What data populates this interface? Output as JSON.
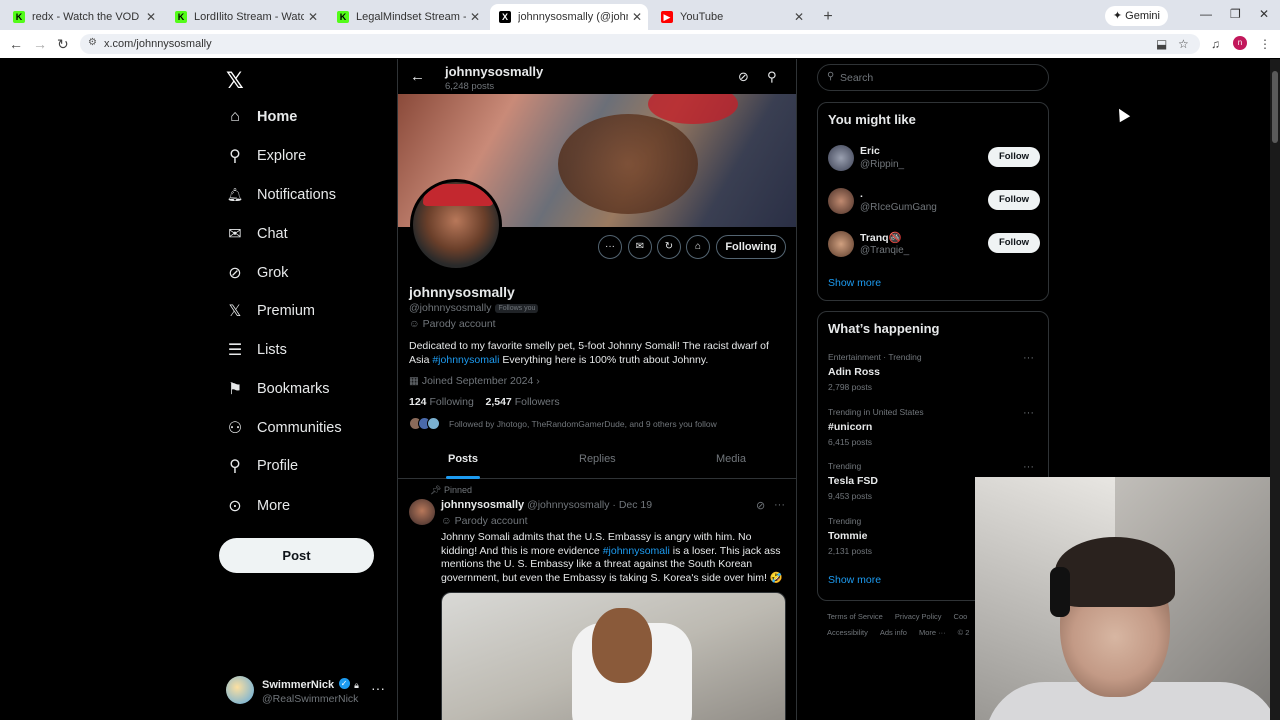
{
  "browser": {
    "tabs": [
      {
        "title": "redx - Watch the VOD on Kick",
        "favicon": "K",
        "color": "#53fc18"
      },
      {
        "title": "LordIlito Stream - Watch Live on Kick",
        "favicon": "K",
        "color": "#53fc18"
      },
      {
        "title": "LegalMindset Stream - Watch Live on Kick",
        "favicon": "K",
        "color": "#53fc18"
      },
      {
        "title": "johnnysosmally (@johnnysosmally) / X",
        "favicon": "X",
        "color": "#000000"
      },
      {
        "title": "YouTube",
        "favicon": "▶",
        "color": "#ff0000"
      }
    ],
    "new_tab": "+",
    "gemini_label": "Gemini",
    "url": "x.com/johnnysosmally",
    "profile_initial": "n"
  },
  "nav": {
    "logo": "𝕏",
    "items": [
      {
        "label": "Home",
        "icon": "home-icon",
        "glyph": "⌂"
      },
      {
        "label": "Explore",
        "icon": "search-icon",
        "glyph": "⚲"
      },
      {
        "label": "Notifications",
        "icon": "bell-icon",
        "glyph": "🔔︎"
      },
      {
        "label": "Chat",
        "icon": "mail-icon",
        "glyph": "✉"
      },
      {
        "label": "Grok",
        "icon": "grok-icon",
        "glyph": "⊘"
      },
      {
        "label": "Premium",
        "icon": "x-logo-icon",
        "glyph": "𝕏"
      },
      {
        "label": "Lists",
        "icon": "lists-icon",
        "glyph": "☰"
      },
      {
        "label": "Bookmarks",
        "icon": "bookmark-icon",
        "glyph": "⚑"
      },
      {
        "label": "Communities",
        "icon": "communities-icon",
        "glyph": "⚇"
      },
      {
        "label": "Profile",
        "icon": "person-icon",
        "glyph": "⚲"
      },
      {
        "label": "More",
        "icon": "more-circle-icon",
        "glyph": "⊙"
      }
    ],
    "post_button": "Post",
    "me": {
      "name": "SwimmerNick",
      "handle": "@RealSwimmerNick"
    }
  },
  "profile": {
    "topbar_name": "johnnysosmally",
    "topbar_posts": "6,248 posts",
    "following_button": "Following",
    "name": "johnnysosmally",
    "handle": "@johnnysosmally",
    "follows_you": "Follows you",
    "parody": "Parody account",
    "bio_pre": "Dedicated to my favorite smelly pet, 5-foot Johnny Somali! The racist dwarf of Asia ",
    "bio_tag": "#johnnysomali",
    "bio_post": " Everything here is 100% truth about Johnny.",
    "joined": "Joined September 2024",
    "following_count": "124",
    "following_label": "Following",
    "followers_count": "2,547",
    "followers_label": "Followers",
    "followed_by": "Followed by Jhotogo, TheRandomGamerDude, and 9 others you follow",
    "tabs": [
      "Posts",
      "Replies",
      "Media"
    ]
  },
  "tweet": {
    "pinned_label": "Pinned",
    "name": "johnnysosmally",
    "handle_date": "@johnnysosmally · Dec 19",
    "parody": "Parody account",
    "text_1": "Johnny Somali admits that the U.S. Embassy is angry with him. No kidding! And this is more evidence ",
    "text_tag": "#johnnysomali",
    "text_2": " is a loser. This jack ass mentions the U. S. Embassy like a threat against the South Korean government, but even the Embassy is taking S. Korea's side over him! 🤣"
  },
  "search": {
    "placeholder": "Search"
  },
  "you_might_like": {
    "title": "You might like",
    "users": [
      {
        "name": "Eric",
        "handle": "@Rippin_",
        "button": "Follow"
      },
      {
        "name": ".",
        "handle": "@RIceGumGang",
        "button": "Follow"
      },
      {
        "name": "Tranq🚳",
        "handle": "@Tranqie_",
        "button": "Follow"
      }
    ],
    "show_more": "Show more"
  },
  "whats_happening": {
    "title": "What’s happening",
    "trends": [
      {
        "meta": "Entertainment · Trending",
        "title": "Adin Ross",
        "posts": "2,798 posts"
      },
      {
        "meta": "Trending in United States",
        "title": "#unicorn",
        "posts": "6,415 posts"
      },
      {
        "meta": "Trending",
        "title": "Tesla FSD",
        "posts": "9,453 posts"
      },
      {
        "meta": "Trending",
        "title": "Tommie",
        "posts": "2,131 posts"
      }
    ],
    "show_more": "Show more"
  },
  "footer": {
    "row1": [
      "Terms of Service",
      "Privacy Policy",
      "Coo"
    ],
    "row2": [
      "Accessibility",
      "Ads info",
      "More ···",
      "© 2"
    ]
  }
}
